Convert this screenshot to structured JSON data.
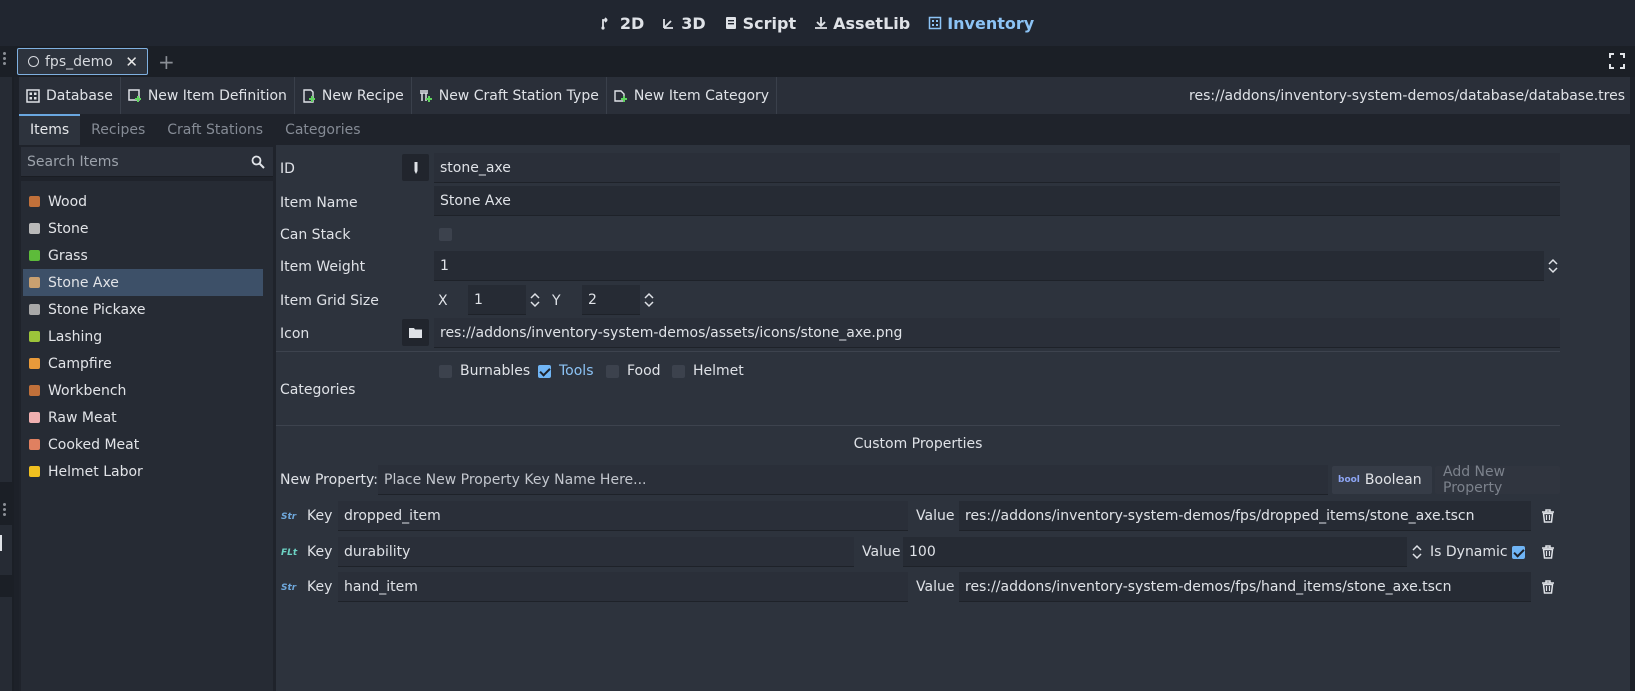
{
  "topbar": {
    "modes": [
      {
        "label": "2D",
        "icon": "2d-icon"
      },
      {
        "label": "3D",
        "icon": "3d-icon"
      },
      {
        "label": "Script",
        "icon": "script-icon"
      },
      {
        "label": "AssetLib",
        "icon": "download-icon"
      },
      {
        "label": "Inventory",
        "icon": "inventory-icon",
        "active": true
      }
    ]
  },
  "scene_tab": {
    "label": "fps_demo"
  },
  "toolbar": {
    "database": "Database",
    "new_item_definition": "New Item Definition",
    "new_recipe": "New Recipe",
    "new_craft_station_type": "New Craft Station Type",
    "new_item_category": "New Item Category",
    "db_path": "res://addons/inventory-system-demos/database/database.tres"
  },
  "tabs": [
    "Items",
    "Recipes",
    "Craft Stations",
    "Categories"
  ],
  "search": {
    "placeholder": "Search Items"
  },
  "items": [
    {
      "label": "Wood",
      "color": "#c0703a"
    },
    {
      "label": "Stone",
      "color": "#b9b9b9"
    },
    {
      "label": "Grass",
      "color": "#5dbb3a"
    },
    {
      "label": "Stone Axe",
      "color": "#c9a070",
      "selected": true
    },
    {
      "label": "Stone Pickaxe",
      "color": "#a8a8a8"
    },
    {
      "label": "Lashing",
      "color": "#9cc43a"
    },
    {
      "label": "Campfire",
      "color": "#e89a3a"
    },
    {
      "label": "Workbench",
      "color": "#c0703a"
    },
    {
      "label": "Raw Meat",
      "color": "#f0b0b0"
    },
    {
      "label": "Cooked Meat",
      "color": "#e08060"
    },
    {
      "label": "Helmet Labor",
      "color": "#f0c020"
    }
  ],
  "form": {
    "id_label": "ID",
    "id_value": "stone_axe",
    "item_name_label": "Item Name",
    "item_name_value": "Stone Axe",
    "can_stack_label": "Can Stack",
    "item_weight_label": "Item Weight",
    "item_weight_value": "1",
    "grid_size_label": "Item Grid Size",
    "grid_x_label": "X",
    "grid_x_value": "1",
    "grid_y_label": "Y",
    "grid_y_value": "2",
    "icon_label": "Icon",
    "icon_value": "res://addons/inventory-system-demos/assets/icons/stone_axe.png",
    "categories_label": "Categories",
    "categories": [
      {
        "label": "Burnables",
        "checked": false
      },
      {
        "label": "Tools",
        "checked": true
      },
      {
        "label": "Food",
        "checked": false
      },
      {
        "label": "Helmet",
        "checked": false
      }
    ]
  },
  "custom_props": {
    "title": "Custom Properties",
    "new_label": "New Property:",
    "new_placeholder": "Place New Property Key Name Here...",
    "type_icon": "bool",
    "type_value": "Boolean",
    "add_button": "Add New Property",
    "key_label": "Key",
    "value_label": "Value",
    "dynamic_label": "Is Dynamic",
    "rows": [
      {
        "type": "Str",
        "key": "dropped_item",
        "value": "res://addons/inventory-system-demos/fps/dropped_items/stone_axe.tscn"
      },
      {
        "type": "FLt",
        "key": "durability",
        "value": "100"
      },
      {
        "type": "Str",
        "key": "hand_item",
        "value": "res://addons/inventory-system-demos/fps/hand_items/stone_axe.tscn"
      }
    ]
  }
}
